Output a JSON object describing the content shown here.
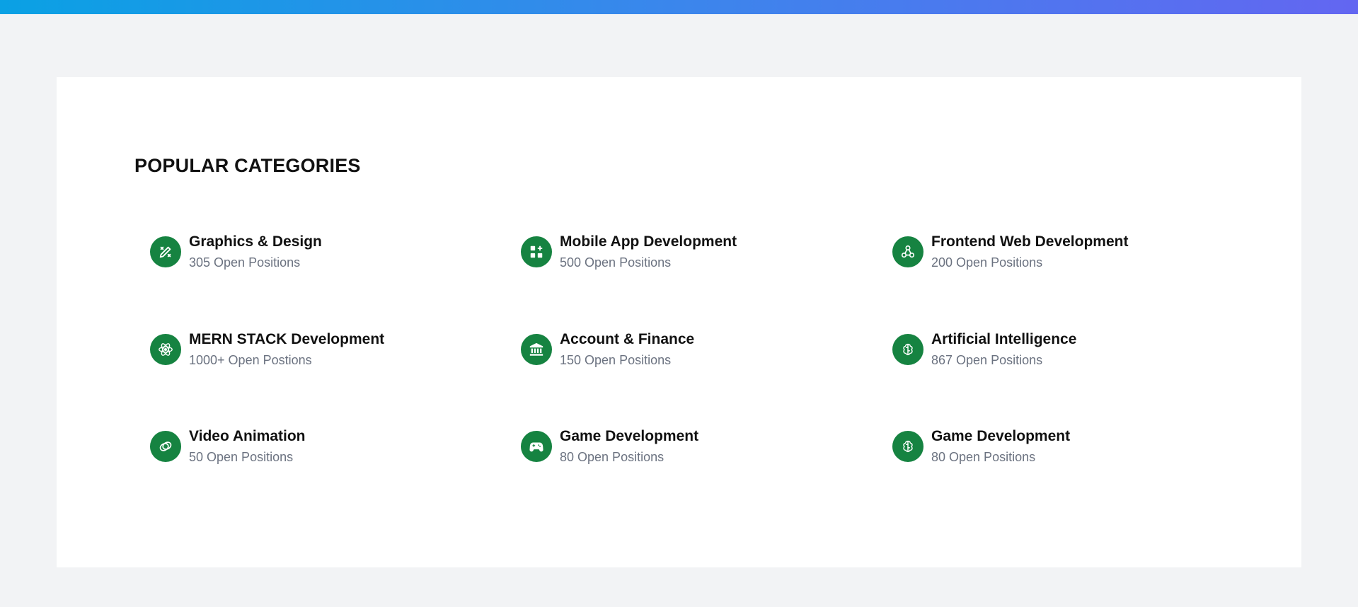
{
  "section": {
    "title": "POPULAR CATEGORIES"
  },
  "categories": [
    {
      "name": "Graphics & Design",
      "count": "305 Open Positions",
      "icon": "design-tools-icon"
    },
    {
      "name": "Mobile App Development",
      "count": "500 Open Positions",
      "icon": "apps-grid-icon"
    },
    {
      "name": "Frontend Web Development",
      "count": "200 Open Positions",
      "icon": "webhook-icon"
    },
    {
      "name": "MERN STACK Development",
      "count": "1000+ Open Postions",
      "icon": "react-atom-icon"
    },
    {
      "name": "Account & Finance",
      "count": "150 Open Positions",
      "icon": "bank-icon"
    },
    {
      "name": "Artificial Intelligence",
      "count": "867 Open Positions",
      "icon": "brain-icon"
    },
    {
      "name": "Video Animation",
      "count": "50 Open Positions",
      "icon": "video-rings-icon"
    },
    {
      "name": "Game Development",
      "count": "80 Open Positions",
      "icon": "gamepad-icon"
    },
    {
      "name": "Game Development",
      "count": "80 Open Positions",
      "icon": "brain-icon"
    }
  ],
  "colors": {
    "accent": "#168341",
    "gradient_start": "#0aa1e4",
    "gradient_end": "#6366f1",
    "background": "#f2f3f5",
    "muted_text": "#6b7280"
  }
}
